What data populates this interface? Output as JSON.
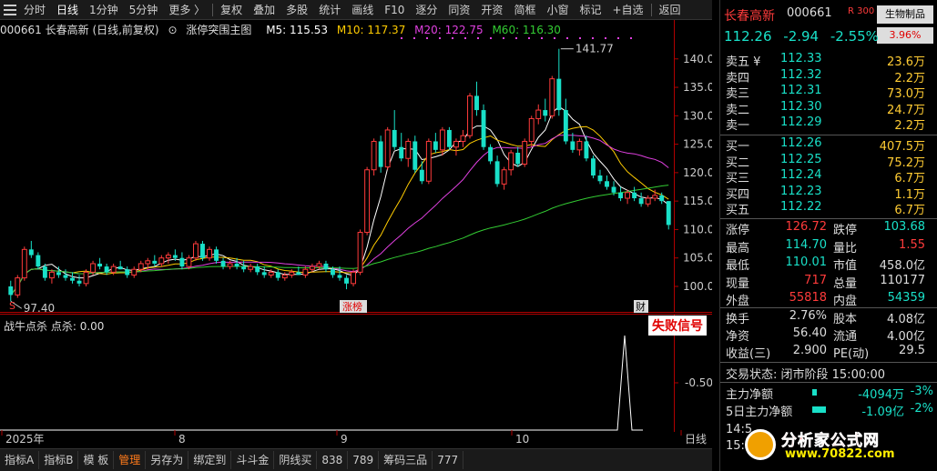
{
  "toolbar": {
    "items": [
      "分时",
      "日线",
      "1分钟",
      "5分钟",
      "更多 〉",
      "复权",
      "叠加",
      "多股",
      "统计",
      "画线",
      "F10",
      "逐分",
      "同资",
      "开资",
      "简框",
      "小窗",
      "标记",
      "+自选",
      "返回"
    ],
    "selected": "日线"
  },
  "chart_info": {
    "title": "000661 长春高新 (日线,前复权)",
    "indicator": "涨停突围主图",
    "ma5": "M5: 115.53",
    "ma10": "M10: 117.37",
    "ma20": "M20: 122.75",
    "ma60": "M60: 116.30"
  },
  "main_chart_labels": {
    "high_marker": "141.77",
    "low_marker": "97.40",
    "zhangbang": "涨榜",
    "cai": "财",
    "s_marker": "S"
  },
  "sub_chart": {
    "title": "战牛点杀",
    "value_text": "点杀: 0.00",
    "fail_label": "失败信号",
    "y_label": "-0.50"
  },
  "x_axis_labels": [
    "2025年",
    "8",
    "9",
    "10",
    "日线"
  ],
  "y_axis_labels": [
    "140.0",
    "135.0",
    "130.0",
    "125.0",
    "120.0",
    "115.0",
    "110.0",
    "105.0",
    "100.0"
  ],
  "bottom_tabs": {
    "items": [
      "指标A",
      "指标B",
      "模 板",
      "管理",
      "另存为",
      "绑定到",
      "斗斗金",
      "阴线买",
      "838",
      "789",
      "筹码三品",
      "777"
    ],
    "selected": "管理"
  },
  "stock": {
    "name": "长春高新",
    "code": "000661",
    "r_badge": "R 300",
    "industry": "生物制品",
    "industry_change": "3.96%",
    "price": "112.26",
    "change": "-2.94",
    "change_pct": "-2.55%"
  },
  "order_book": {
    "asks": [
      {
        "label": "卖五 ¥",
        "price": "112.33",
        "vol": "23.6万"
      },
      {
        "label": "卖四",
        "price": "112.32",
        "vol": "2.2万"
      },
      {
        "label": "卖三",
        "price": "112.31",
        "vol": "73.0万"
      },
      {
        "label": "卖二",
        "price": "112.30",
        "vol": "24.7万"
      },
      {
        "label": "卖一",
        "price": "112.29",
        "vol": "2.2万"
      }
    ],
    "bids": [
      {
        "label": "买一",
        "price": "112.26",
        "vol": "407.5万"
      },
      {
        "label": "买二",
        "price": "112.25",
        "vol": "75.2万"
      },
      {
        "label": "买三",
        "price": "112.24",
        "vol": "6.7万"
      },
      {
        "label": "买四",
        "price": "112.23",
        "vol": "1.1万"
      },
      {
        "label": "买五",
        "price": "112.22",
        "vol": "6.7万"
      }
    ]
  },
  "stats1": [
    {
      "l1": "涨停",
      "v1": "126.72",
      "c1": "#ff3b3b",
      "l2": "跌停",
      "v2": "103.68",
      "c2": "#19e0c8"
    },
    {
      "l1": "最高",
      "v1": "114.70",
      "c1": "#19e0c8",
      "l2": "量比",
      "v2": "1.55",
      "c2": "#ff3b3b"
    },
    {
      "l1": "最低",
      "v1": "110.01",
      "c1": "#19e0c8",
      "l2": "市值",
      "v2": "458.0亿",
      "c2": "#ddd"
    },
    {
      "l1": "现量",
      "v1": "717",
      "c1": "#ff3b3b",
      "l2": "总量",
      "v2": "110177",
      "c2": "#ddd"
    },
    {
      "l1": "外盘",
      "v1": "55818",
      "c1": "#ff3b3b",
      "l2": "内盘",
      "v2": "54359",
      "c2": "#19e0c8"
    }
  ],
  "stats2": [
    {
      "l1": "换手",
      "v1": "2.76%",
      "l2": "股本",
      "v2": "4.08亿"
    },
    {
      "l1": "净资",
      "v1": "56.40",
      "l2": "流通",
      "v2": "4.00亿"
    },
    {
      "l1": "收益(三)",
      "v1": "2.900",
      "l2": "PE(动)",
      "v2": "29.5"
    }
  ],
  "trade_status": "交易状态: 闭市阶段 15:00:00",
  "flows": [
    {
      "label": "主力净额",
      "value": "-4094万",
      "pct": "-3%",
      "bar": 0.15
    },
    {
      "label": "5日主力净额",
      "value": "-1.09亿",
      "pct": "-2%",
      "bar": 0.5
    }
  ],
  "times": [
    "14:5",
    "15:0"
  ],
  "watermark": {
    "top": "分析家公式网",
    "bottom": "www.70822.com"
  },
  "colors": {
    "up": "#ff3b3b",
    "down": "#19e0c8",
    "ma5": "#ffffff",
    "ma10": "#ffcc00",
    "ma20": "#e040e0",
    "ma60": "#33cc33"
  },
  "chart_data": {
    "type": "candlestick",
    "ylim": [
      96,
      143
    ],
    "candles": [
      [
        100,
        101,
        97.4,
        98.5
      ],
      [
        98.5,
        102,
        98,
        101.5
      ],
      [
        101.5,
        107,
        101,
        106.5
      ],
      [
        106.5,
        108,
        105,
        105.5
      ],
      [
        105.5,
        106,
        103,
        103.5
      ],
      [
        103.5,
        104,
        101,
        101.5
      ],
      [
        101.5,
        103,
        100.5,
        102.5
      ],
      [
        102.5,
        103.5,
        101.5,
        102
      ],
      [
        102,
        103,
        101,
        101.5
      ],
      [
        101.5,
        102.5,
        100.5,
        101
      ],
      [
        101,
        102,
        100,
        100.5
      ],
      [
        100.5,
        103,
        100,
        102.5
      ],
      [
        102.5,
        104.5,
        102,
        104
      ],
      [
        104,
        105,
        103,
        103.5
      ],
      [
        103.5,
        104,
        102,
        102.5
      ],
      [
        102.5,
        104,
        102,
        103.5
      ],
      [
        103.5,
        104.5,
        103,
        103
      ],
      [
        103,
        103.5,
        101.5,
        102
      ],
      [
        102,
        103.5,
        101.5,
        103
      ],
      [
        103,
        104.5,
        102.5,
        104
      ],
      [
        104,
        105,
        103,
        104.5
      ],
      [
        104.5,
        105.5,
        103.5,
        104
      ],
      [
        104,
        105.5,
        103.5,
        105
      ],
      [
        105,
        106,
        104,
        105.5
      ],
      [
        105.5,
        106.5,
        104.5,
        105
      ],
      [
        105,
        106,
        103,
        103.5
      ],
      [
        103.5,
        105.5,
        103,
        105
      ],
      [
        105,
        108,
        104.5,
        107.5
      ],
      [
        107.5,
        108,
        104.5,
        105
      ],
      [
        105,
        107,
        104.5,
        106.5
      ],
      [
        106.5,
        107,
        104,
        104.5
      ],
      [
        104.5,
        105,
        103,
        103.5
      ],
      [
        103.5,
        104.5,
        103,
        104
      ],
      [
        104,
        105,
        103,
        103.5
      ],
      [
        103.5,
        104.5,
        102.5,
        103
      ],
      [
        103,
        104,
        102.5,
        103.5
      ],
      [
        103.5,
        104,
        102,
        102.5
      ],
      [
        102.5,
        103.5,
        101.5,
        102
      ],
      [
        102,
        103,
        101.5,
        102.5
      ],
      [
        102.5,
        103,
        101,
        101.5
      ],
      [
        101.5,
        102.5,
        101,
        102
      ],
      [
        102,
        103,
        101.5,
        102.5
      ],
      [
        102.5,
        103.5,
        102,
        102
      ],
      [
        102,
        103.5,
        101.5,
        103
      ],
      [
        103,
        104,
        102.5,
        103.5
      ],
      [
        103.5,
        104.5,
        103,
        104
      ],
      [
        104,
        104.5,
        102.5,
        103
      ],
      [
        103,
        103.5,
        101.5,
        102
      ],
      [
        102,
        103.5,
        101,
        101.5
      ],
      [
        101.5,
        102,
        99.5,
        100.5
      ],
      [
        100.5,
        103,
        100,
        102.5
      ],
      [
        102.5,
        110,
        102,
        109.5
      ],
      [
        109.5,
        121,
        109,
        120.5
      ],
      [
        120.5,
        126,
        119.5,
        125.5
      ],
      [
        125.5,
        126.5,
        120,
        121
      ],
      [
        121,
        128,
        120.5,
        127.5
      ],
      [
        127.5,
        131,
        124,
        124.5
      ],
      [
        124.5,
        127,
        122,
        122.5
      ],
      [
        122.5,
        126,
        121,
        125.5
      ],
      [
        125.5,
        126.5,
        120,
        120.5
      ],
      [
        120.5,
        122,
        118,
        118.5
      ],
      [
        118.5,
        126,
        118,
        125.5
      ],
      [
        125.5,
        127,
        123.5,
        124
      ],
      [
        124,
        128,
        123,
        127.5
      ],
      [
        127.5,
        128,
        124,
        124.5
      ],
      [
        124.5,
        126,
        123,
        125.5
      ],
      [
        125.5,
        127.5,
        124.5,
        126.5
      ],
      [
        126.5,
        134,
        126,
        133.5
      ],
      [
        133.5,
        136,
        130,
        131
      ],
      [
        131,
        132,
        124,
        124.5
      ],
      [
        124.5,
        125,
        121.5,
        122
      ],
      [
        122,
        123,
        117.5,
        118
      ],
      [
        118,
        121,
        117,
        120.5
      ],
      [
        120.5,
        124,
        119.5,
        123.5
      ],
      [
        123.5,
        124.5,
        121,
        121.5
      ],
      [
        121.5,
        126,
        121,
        125.5
      ],
      [
        125.5,
        130,
        124.5,
        129.5
      ],
      [
        129.5,
        132,
        128.5,
        131
      ],
      [
        131,
        133,
        129,
        130
      ],
      [
        130,
        137,
        129.5,
        136.5
      ],
      [
        136.5,
        141.77,
        130,
        131
      ],
      [
        131,
        133,
        125,
        125.5
      ],
      [
        125.5,
        127,
        123.5,
        124
      ],
      [
        124,
        126,
        123,
        125.5
      ],
      [
        125.5,
        126.5,
        122,
        122.5
      ],
      [
        122.5,
        123,
        119,
        119.5
      ],
      [
        119.5,
        120.5,
        118,
        118.5
      ],
      [
        118.5,
        119.5,
        117,
        117.5
      ],
      [
        117.5,
        118.5,
        116,
        116.5
      ],
      [
        116.5,
        117.5,
        115,
        115.5
      ],
      [
        115.5,
        117,
        114.5,
        116.5
      ],
      [
        116.5,
        117.5,
        115,
        115.5
      ],
      [
        115.5,
        116.5,
        114,
        114.5
      ],
      [
        114.5,
        116,
        114,
        115.5
      ],
      [
        115.5,
        117,
        115,
        116
      ],
      [
        116,
        116.5,
        114.5,
        115
      ],
      [
        115,
        115,
        110.01,
        110.8
      ]
    ]
  }
}
